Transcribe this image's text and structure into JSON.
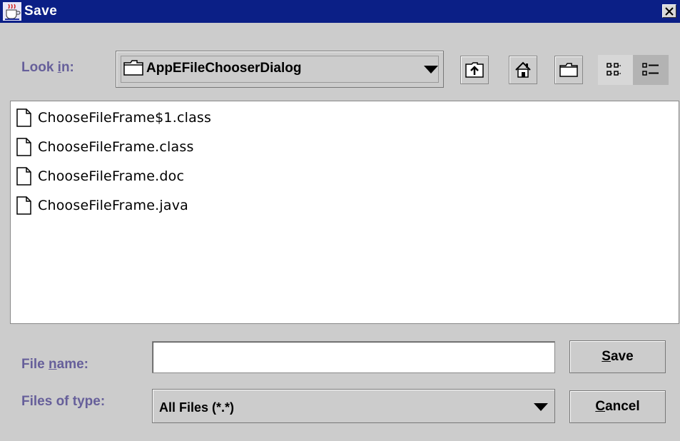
{
  "window": {
    "title": "Save",
    "close_glyph": "✕",
    "title_bar_color": "#0b1f86"
  },
  "lookin": {
    "label_pre": "Look ",
    "label_mnemonic": "i",
    "label_post": "n:",
    "value": "AppEFileChooserDialog",
    "icon": "folder-icon"
  },
  "toolbar": {
    "up_icon": "up-folder-icon",
    "home_icon": "home-icon",
    "new_folder_icon": "new-folder-icon",
    "list_view_icon": "list-view-icon",
    "details_view_icon": "details-view-icon"
  },
  "files": [
    {
      "name": "ChooseFileFrame$1.class",
      "icon": "file-icon"
    },
    {
      "name": "ChooseFileFrame.class",
      "icon": "file-icon"
    },
    {
      "name": "ChooseFileFrame.doc",
      "icon": "file-icon"
    },
    {
      "name": "ChooseFileFrame.java",
      "icon": "file-icon"
    }
  ],
  "file_name": {
    "label_pre": "File ",
    "label_mnemonic": "n",
    "label_post": "ame:",
    "value": ""
  },
  "file_type": {
    "label": "Files of type:",
    "value": "All Files (*.*)"
  },
  "buttons": {
    "save_mnemonic": "S",
    "save_rest": "ave",
    "cancel_mnemonic": "C",
    "cancel_rest": "ancel"
  },
  "colors": {
    "label": "#665f9a",
    "background": "#cccccc"
  }
}
